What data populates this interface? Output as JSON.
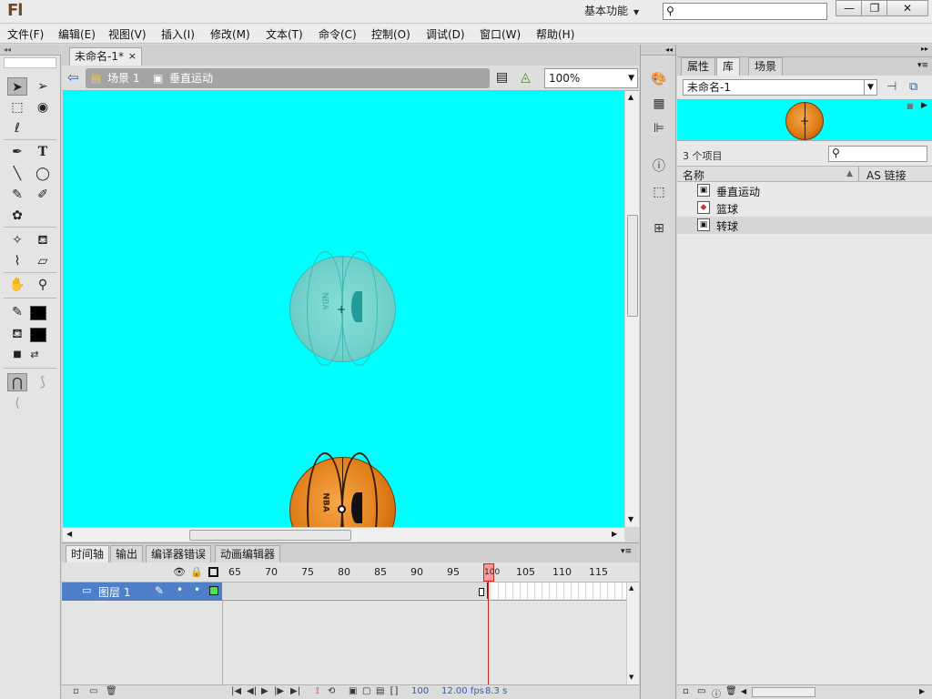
{
  "app": {
    "logo": "Fl",
    "workspace_label": "基本功能",
    "search_placeholder": ""
  },
  "window_controls": {
    "minimize": "—",
    "restore": "❐",
    "close": "✕"
  },
  "menu": [
    "文件(F)",
    "编辑(E)",
    "视图(V)",
    "插入(I)",
    "修改(M)",
    "文本(T)",
    "命令(C)",
    "控制(O)",
    "调试(D)",
    "窗口(W)",
    "帮助(H)"
  ],
  "document": {
    "tab_title": "未命名-1*",
    "tab_close": "×"
  },
  "editbar": {
    "scene": "场景 1",
    "symbol": "垂直运动",
    "zoom": "100%"
  },
  "timeline": {
    "tabs": [
      "时间轴",
      "输出",
      "编译器错误",
      "动画编辑器"
    ],
    "frame_numbers": [
      "65",
      "70",
      "75",
      "80",
      "85",
      "90",
      "95",
      "100",
      "105",
      "110",
      "115"
    ],
    "current_frame_marker": "100",
    "layer_name": "图层 1",
    "footer": {
      "current_frame": "100",
      "fps": "12.00 fps",
      "time": "8.3 s"
    }
  },
  "library": {
    "tabs": [
      "属性",
      "库",
      "场景"
    ],
    "active_tab": "库",
    "document": "未命名-1",
    "item_count": "3 个项目",
    "columns": {
      "name": "名称",
      "linkage": "AS 链接"
    },
    "items": [
      {
        "label": "垂直运动",
        "icon": "movieclip-icon"
      },
      {
        "label": "篮球",
        "icon": "graphic-icon"
      },
      {
        "label": "转球",
        "icon": "movieclip-icon"
      }
    ],
    "selected_index": 2
  },
  "stage": {
    "background": "#00ffff",
    "ball_label": "NBA"
  }
}
